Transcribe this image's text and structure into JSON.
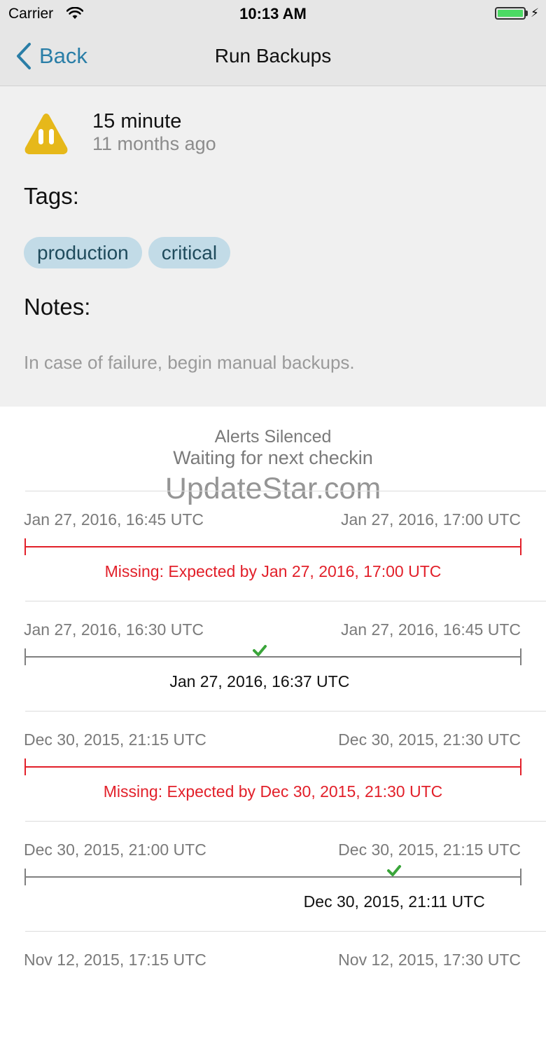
{
  "status_bar": {
    "carrier": "Carrier",
    "time": "10:13 AM",
    "battery_level": 1.0,
    "battery_color": "#4cd964"
  },
  "nav": {
    "back_label": "Back",
    "title": "Run Backups",
    "accent_color": "#2a7ea7"
  },
  "check": {
    "status_icon": "pause-warning-icon",
    "status_color": "#e6b81a",
    "interval": "15 minute",
    "last_seen": "11 months ago",
    "tags_label": "Tags:",
    "tags": [
      "production",
      "critical"
    ],
    "notes_label": "Notes:",
    "notes": "In case of failure, begin manual backups."
  },
  "summary": {
    "line1": "Alerts Silenced",
    "line2": "Waiting for next checkin"
  },
  "watermark": "UpdateStar.com",
  "checkins": [
    {
      "start": "Jan 27, 2016, 16:45 UTC",
      "end": "Jan 27, 2016, 17:00 UTC",
      "status": "missing",
      "message": "Missing: Expected by Jan 27, 2016, 17:00 UTC"
    },
    {
      "start": "Jan 27, 2016, 16:30 UTC",
      "end": "Jan 27, 2016, 16:45 UTC",
      "status": "ok",
      "checkin": "Jan 27, 2016, 16:37 UTC",
      "position": 0.473
    },
    {
      "start": "Dec 30, 2015, 21:15 UTC",
      "end": "Dec 30, 2015, 21:30 UTC",
      "status": "missing",
      "message": "Missing: Expected by Dec 30, 2015, 21:30 UTC"
    },
    {
      "start": "Dec 30, 2015, 21:00 UTC",
      "end": "Dec 30, 2015, 21:15 UTC",
      "status": "ok",
      "checkin": "Dec 30, 2015, 21:11 UTC",
      "position": 0.744
    },
    {
      "start": "Nov 12, 2015, 17:15 UTC",
      "end": "Nov 12, 2015, 17:30 UTC",
      "status": "partial"
    }
  ]
}
